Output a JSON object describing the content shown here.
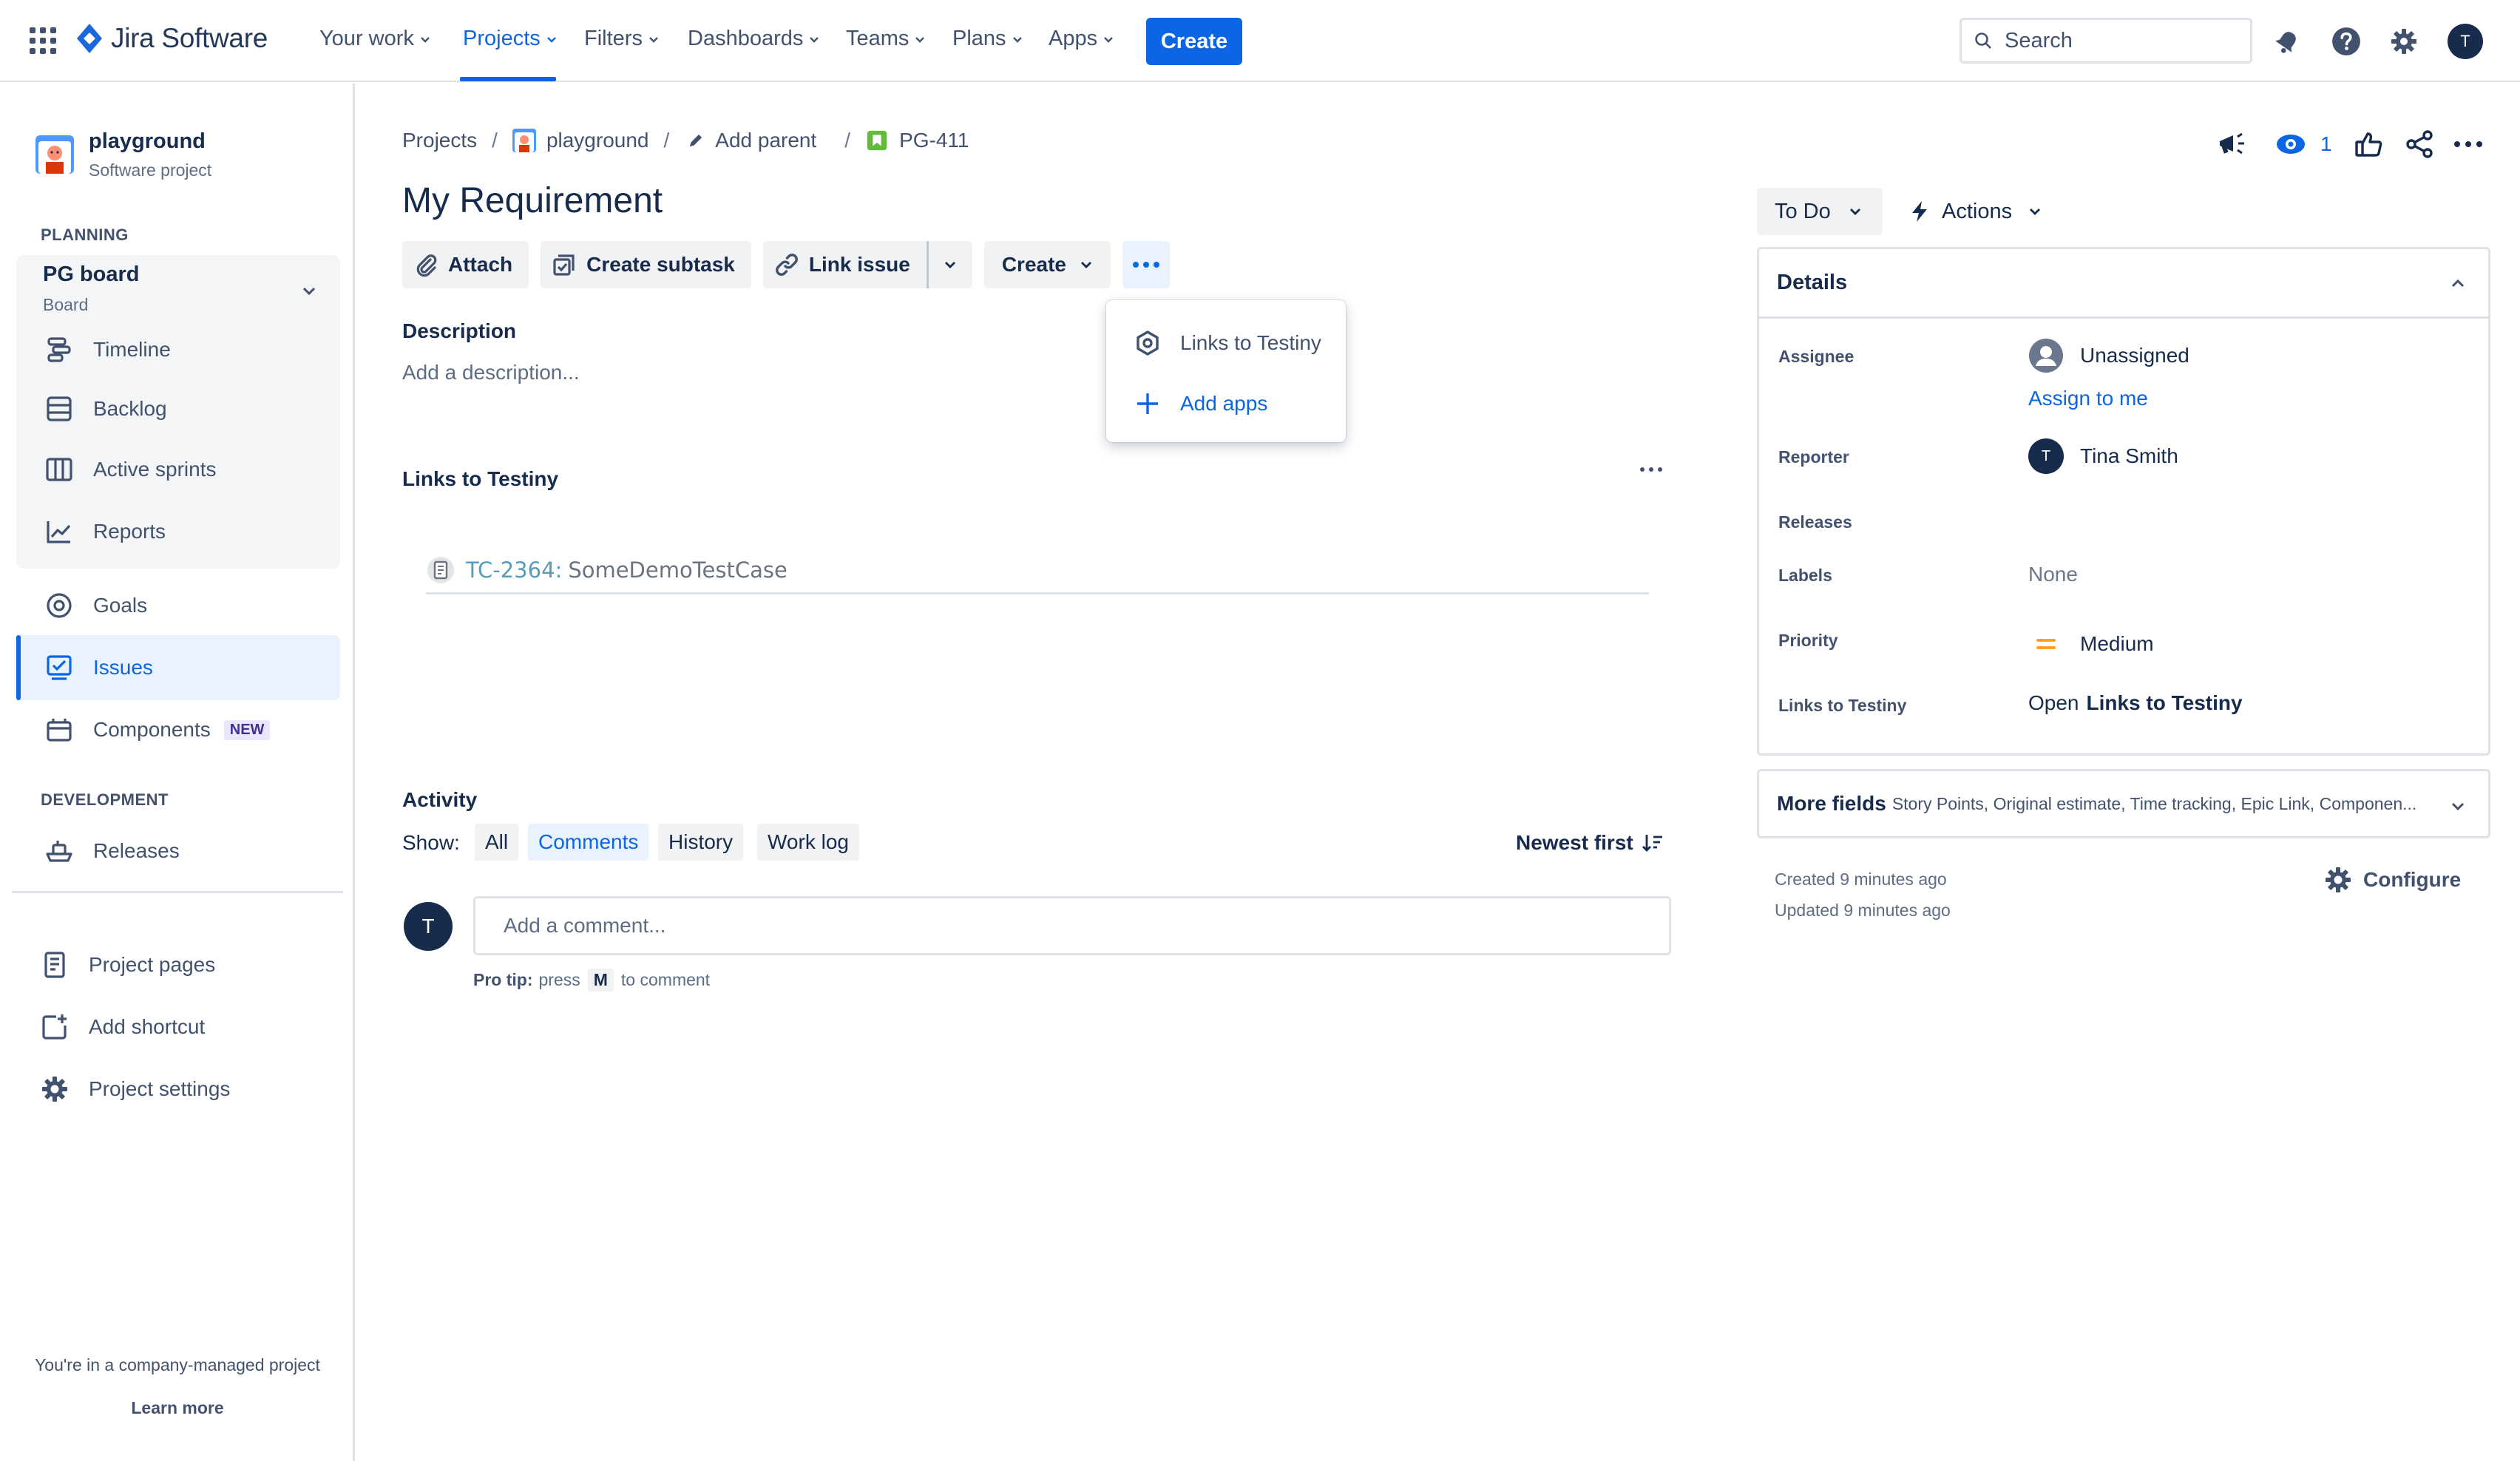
{
  "topnav": {
    "logo_text": "Jira Software",
    "items": [
      {
        "label": "Your work"
      },
      {
        "label": "Projects"
      },
      {
        "label": "Filters"
      },
      {
        "label": "Dashboards"
      },
      {
        "label": "Teams"
      },
      {
        "label": "Plans"
      },
      {
        "label": "Apps"
      }
    ],
    "create_label": "Create",
    "search_placeholder": "Search",
    "avatar_initial": "T",
    "accent": "#0c66e4"
  },
  "sidebar": {
    "project_name": "playground",
    "project_type": "Software project",
    "planning_heading": "PLANNING",
    "board_name": "PG board",
    "board_sub": "Board",
    "planning_items": [
      {
        "label": "Timeline",
        "icon": "timeline-icon"
      },
      {
        "label": "Backlog",
        "icon": "backlog-icon"
      },
      {
        "label": "Active sprints",
        "icon": "board-columns-icon"
      },
      {
        "label": "Reports",
        "icon": "reports-chart-icon"
      }
    ],
    "items": [
      {
        "label": "Goals",
        "icon": "goals-icon"
      },
      {
        "label": "Issues",
        "icon": "issues-icon"
      },
      {
        "label": "Components",
        "icon": "components-icon",
        "badge": "NEW"
      }
    ],
    "development_heading": "DEVELOPMENT",
    "dev_items": [
      {
        "label": "Releases",
        "icon": "releases-ship-icon"
      }
    ],
    "bottom_items": [
      {
        "label": "Project pages",
        "icon": "page-icon"
      },
      {
        "label": "Add shortcut",
        "icon": "add-shortcut-icon"
      },
      {
        "label": "Project settings",
        "icon": "gear-icon"
      }
    ],
    "footer_text": "You're in a company-managed project",
    "footer_link": "Learn more"
  },
  "breadcrumb": {
    "projects": "Projects",
    "project": "playground",
    "add_parent": "Add parent",
    "issue_key": "PG-411"
  },
  "issue": {
    "title": "My Requirement",
    "actions": {
      "attach": "Attach",
      "create_subtask": "Create subtask",
      "link_issue": "Link issue",
      "create": "Create"
    },
    "dropdown": {
      "items": [
        {
          "label": "Links to Testiny",
          "icon": "testiny-hexagon-icon"
        },
        {
          "label": "Add apps",
          "icon": "plus-icon"
        }
      ]
    },
    "description_label": "Description",
    "description_placeholder": "Add a description...",
    "testiny_section_label": "Links to Testiny",
    "test_case": {
      "id": "TC-2364:",
      "name": "SomeDemoTestCase"
    }
  },
  "activity": {
    "label": "Activity",
    "show_label": "Show:",
    "tabs": [
      {
        "label": "All"
      },
      {
        "label": "Comments",
        "active": true
      },
      {
        "label": "History"
      },
      {
        "label": "Work log"
      }
    ],
    "sort_label": "Newest first",
    "comment_avatar": "T",
    "comment_placeholder": "Add a comment...",
    "protip_bold": "Pro tip:",
    "protip_press": "press",
    "protip_key": "M",
    "protip_rest": "to comment"
  },
  "right_panel": {
    "watch_count": "1",
    "status": "To Do",
    "actions_label": "Actions",
    "details_title": "Details",
    "fields": {
      "assignee_label": "Assignee",
      "assignee_value": "Unassigned",
      "assign_to_me": "Assign to me",
      "reporter_label": "Reporter",
      "reporter_initial": "T",
      "reporter_value": "Tina Smith",
      "releases_label": "Releases",
      "labels_label": "Labels",
      "labels_value": "None",
      "priority_label": "Priority",
      "priority_value": "Medium",
      "testiny_label": "Links to Testiny",
      "testiny_open": "Open",
      "testiny_value": "Links to Testiny"
    },
    "more_fields_title": "More fields",
    "more_fields_list": "Story Points, Original estimate, Time tracking, Epic Link, Componen...",
    "created": "Created 9 minutes ago",
    "updated": "Updated 9 minutes ago",
    "configure": "Configure",
    "priority_color": "#ff991f"
  }
}
